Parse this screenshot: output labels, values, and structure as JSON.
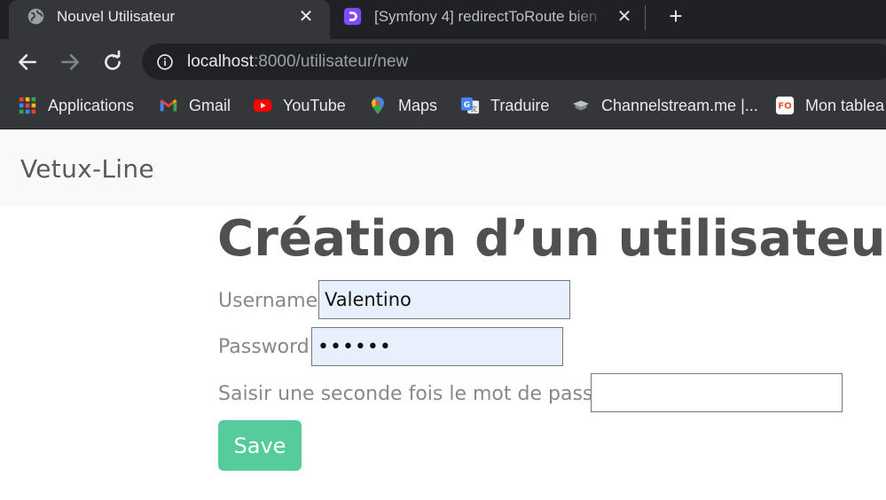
{
  "browser": {
    "tabs": [
      {
        "title": "Nouvel Utilisateur",
        "active": true,
        "favicon": "globe-icon"
      },
      {
        "title": "[Symfony 4] redirectToRoute bien",
        "active": false,
        "favicon": "discord-style-icon"
      }
    ],
    "close_glyph": "✕",
    "new_tab_glyph": "+",
    "url_host": "localhost",
    "url_rest": ":8000/utilisateur/new",
    "bookmarks": [
      {
        "label": "Applications",
        "icon": "apps-grid-icon"
      },
      {
        "label": "Gmail",
        "icon": "gmail-icon"
      },
      {
        "label": "YouTube",
        "icon": "youtube-icon"
      },
      {
        "label": "Maps",
        "icon": "maps-pin-icon"
      },
      {
        "label": "Traduire",
        "icon": "translate-icon"
      },
      {
        "label": "Channelstream.me |...",
        "icon": "channelstream-icon"
      },
      {
        "label": "Mon tablea",
        "icon": "tableau-icon"
      }
    ]
  },
  "site": {
    "brand": "Vetux-Line"
  },
  "form": {
    "title": "Création d’un utilisateur",
    "username_label": "Username",
    "username_value": "Valentino",
    "password_label": "Password",
    "password_mask": "••••••",
    "confirm_label": "Saisir une seconde fois le mot de passe",
    "confirm_value": "",
    "save_label": "Save"
  },
  "colors": {
    "chrome_dark": "#202124",
    "chrome_toolbar": "#35363a",
    "navbar_bg": "#f8f9fa",
    "save_button": "#56cc9d",
    "autofill_bg": "#e8f0fe"
  }
}
